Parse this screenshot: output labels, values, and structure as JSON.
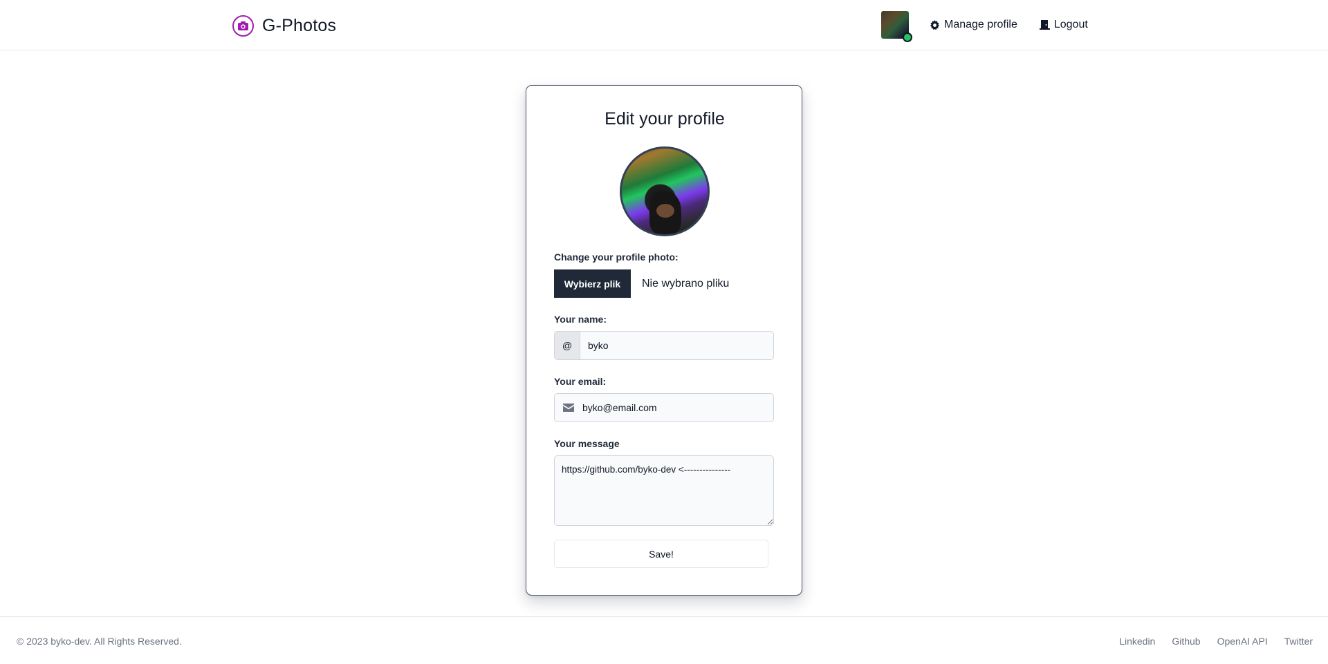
{
  "header": {
    "brand_name": "G-Photos",
    "brand_icon": "camera-icon",
    "nav": {
      "manage_profile_label": "Manage profile",
      "manage_profile_icon": "gear-icon",
      "logout_label": "Logout",
      "logout_icon": "door-icon"
    }
  },
  "card": {
    "title": "Edit your profile",
    "photo_label": "Change your profile photo:",
    "file_button_label": "Wybierz plik",
    "file_status": "Nie wybrano pliku",
    "name_label": "Your name:",
    "name_prefix": "@",
    "name_value": "byko",
    "email_label": "Your email:",
    "email_value": "byko@email.com",
    "message_label": "Your message",
    "message_value": "https://github.com/byko-dev <---------------",
    "save_label": "Save!"
  },
  "footer": {
    "copyright": "© 2023 byko-dev. All Rights Reserved.",
    "links": [
      "Linkedin",
      "Github",
      "OpenAI API",
      "Twitter"
    ]
  },
  "colors": {
    "accent": "#a21caf",
    "dark_button": "#1f2937",
    "status_online": "#22c55e"
  }
}
